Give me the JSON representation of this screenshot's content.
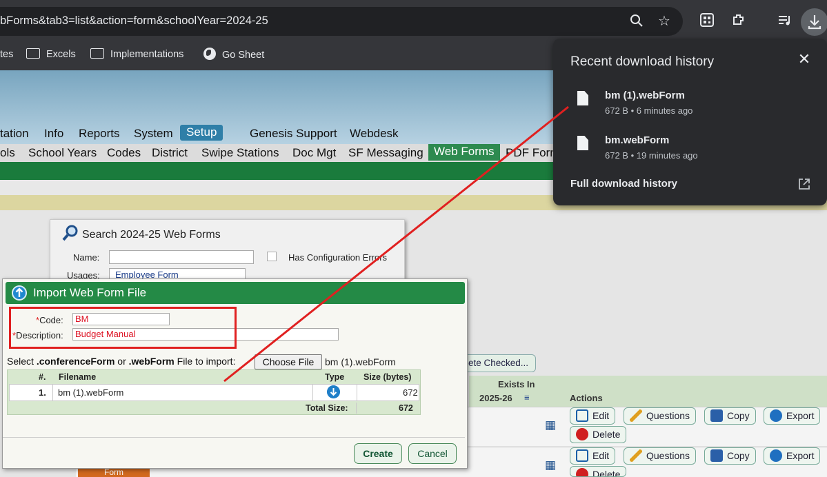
{
  "browser": {
    "url": "bForms&tab3=list&action=form&schoolYear=2024-25",
    "bookmarks": [
      "tes",
      "Excels",
      "Implementations",
      "Go Sheet"
    ]
  },
  "app": {
    "main_menu": [
      "tation",
      "Info",
      "Reports",
      "System",
      "Setup",
      "Genesis Support",
      "Webdesk"
    ],
    "sub_menu": [
      "ols",
      "School Years",
      "Codes",
      "District",
      "Swipe Stations",
      "Doc Mgt",
      "SF Messaging",
      "Web Forms",
      "PDF Form"
    ]
  },
  "search": {
    "title": "Search 2024-25 Web Forms",
    "name_label": "Name:",
    "config_errors_label": "Has Configuration Errors",
    "usages_label": "Usages:",
    "usages_value": "Employee Form"
  },
  "table": {
    "delete_checked": "ete Checked...",
    "exists_in_label": "Exists In",
    "exists_in_year": "2025-26",
    "actions_label": "Actions",
    "action_buttons": [
      "Edit",
      "Questions",
      "Copy",
      "Export",
      "Delete"
    ],
    "row_tab": "Form"
  },
  "dialog": {
    "title": "Import Web Form File",
    "code_label": "Code:",
    "code_value": "BM",
    "description_label": "Description:",
    "description_value": "Budget Manual",
    "select_prefix": "Select ",
    "select_ext1": ".conferenceForm",
    "select_or": " or ",
    "select_ext2": ".webForm",
    "select_suffix": " File to import:",
    "choose_file": "Choose File",
    "chosen_file": "bm (1).webForm",
    "columns": [
      "#.",
      "Filename",
      "Type",
      "Size (bytes)"
    ],
    "rows": [
      {
        "num": "1.",
        "filename": "bm (1).webForm",
        "size": "672"
      }
    ],
    "total_label": "Total Size:",
    "total_value": "672",
    "create": "Create",
    "cancel": "Cancel"
  },
  "downloads": {
    "title": "Recent download history",
    "items": [
      {
        "name": "bm (1).webForm",
        "meta": "672 B • 6 minutes ago"
      },
      {
        "name": "bm.webForm",
        "meta": "672 B • 19 minutes ago"
      }
    ],
    "full_history": "Full download history"
  },
  "colors": {
    "annotation": "#e02020",
    "header_green": "#248a46"
  }
}
